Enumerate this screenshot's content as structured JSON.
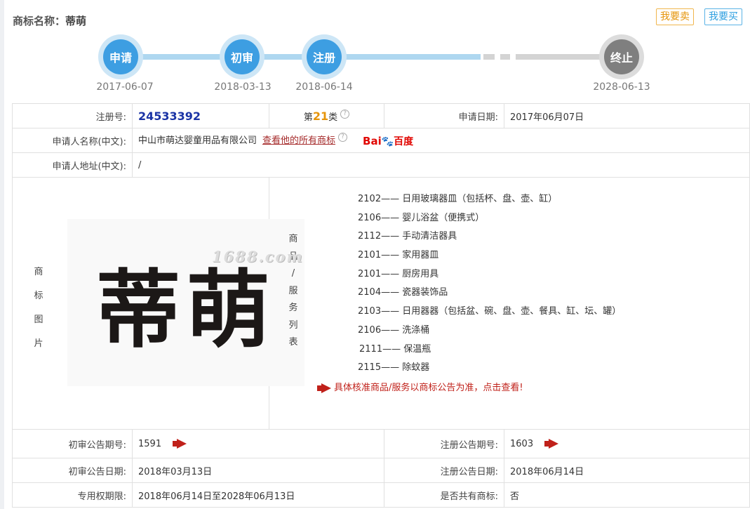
{
  "header": {
    "title_label": "商标名称：",
    "title_value": "蒂萌",
    "sell_button": "我要卖",
    "buy_button": "我要买"
  },
  "timeline": {
    "steps": [
      {
        "label": "申请",
        "date": "2017-06-07",
        "status": "done"
      },
      {
        "label": "初审",
        "date": "2018-03-13",
        "status": "done"
      },
      {
        "label": "注册",
        "date": "2018-06-14",
        "status": "done"
      },
      {
        "label": "终止",
        "date": "2028-06-13",
        "status": "pending"
      }
    ]
  },
  "info": {
    "reg_no_label": "注册号:",
    "reg_no": "24533392",
    "class_prefix": "第",
    "class_num": "21",
    "class_suffix": "类",
    "apply_date_label": "申请日期:",
    "apply_date": "2017年06月07日",
    "applicant_label": "申请人名称(中文):",
    "applicant": "中山市萌达婴童用品有限公司",
    "applicant_link": "查看他的所有商标",
    "baidu_text1": "Bai",
    "baidu_paw": "🐾",
    "baidu_text2": "百度",
    "address_label": "申请人地址(中文):",
    "address": "/",
    "image_label_chars": [
      "商",
      "标",
      "图",
      "片"
    ],
    "logo_text": "蒂萌",
    "watermark": "1688.com",
    "svc_label_chars": [
      "商",
      "品",
      "/",
      "服",
      "务",
      "列",
      "表"
    ],
    "services": [
      "2102—— 日用玻璃器皿（包括杯、盘、壶、缸）",
      "2106—— 婴儿浴盆（便携式）",
      "2112—— 手动清洁器具",
      "2101—— 家用器皿",
      "2101—— 厨房用具",
      "2104—— 瓷器装饰品",
      "2103—— 日用器器（包括盆、碗、盘、壶、餐具、缸、坛、罐）",
      "2106—— 洗涤桶",
      "2111—— 保温瓶",
      "2115—— 除蚊器"
    ],
    "notice": "具体核准商品/服务以商标公告为准，点击查看!",
    "prelim_no_label": "初审公告期号:",
    "prelim_no": "1591",
    "reg_pub_no_label": "注册公告期号:",
    "reg_pub_no": "1603",
    "prelim_date_label": "初审公告日期:",
    "prelim_date": "2018年03月13日",
    "reg_pub_date_label": "注册公告日期:",
    "reg_pub_date": "2018年06月14日",
    "right_period_label": "专用权期限:",
    "right_period": "2018年06月14日至2028年06月13日",
    "shared_label": "是否共有商标:",
    "shared": "否"
  }
}
